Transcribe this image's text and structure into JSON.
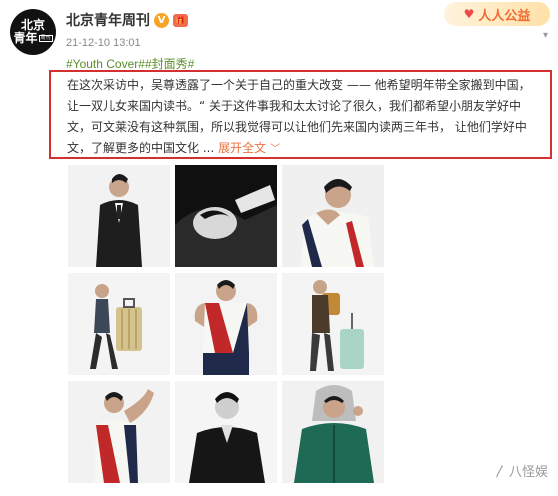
{
  "account": {
    "avatar_line1": "北京",
    "avatar_line2": "青年",
    "avatar_mini": "周刊",
    "name": "北京青年周刊",
    "verified_icon": "V",
    "gift_icon": "gift-icon",
    "timestamp": "21-12-10 13:01"
  },
  "promo": {
    "text": "人人公益",
    "icon": "heart-icon"
  },
  "post": {
    "tags": "#Youth Cover##封面秀#",
    "text": "在这次采访中，吴尊透露了一个关于自己的重大改变 —— 他希望明年带全家搬到中国，让一双儿女来国内读书。“ 关于这件事我和太太讨论了很久，我们都希望小朋友学好中文，可文莱没有这种氛围，所以我觉得可以让他们先来国内读两三年书， 让他们学好中文，了解更多的中国文化 ...",
    "expand_label": "展开全文",
    "expand_icon": "chevron-down-icon"
  },
  "watermark": {
    "text": "八怪娱",
    "icon": "wave-icon"
  },
  "colors": {
    "tag_green": "#5a8f2a",
    "highlight_red": "#d43030",
    "link_orange": "#eb7340"
  }
}
